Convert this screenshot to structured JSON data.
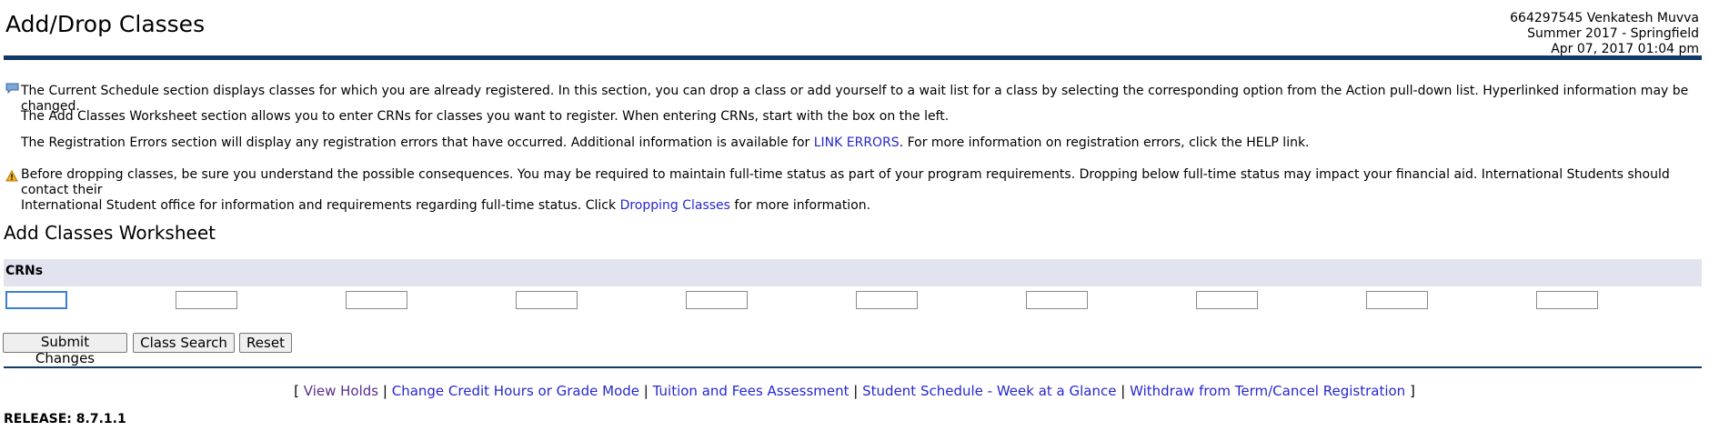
{
  "header": {
    "title": "Add/Drop Classes",
    "user_line": "664297545 Venkatesh Muvva",
    "term_line": "Summer 2017 - Springfield",
    "date_line": "Apr 07, 2017 01:04 pm"
  },
  "info": {
    "line1": "The Current Schedule section displays classes for which you are already registered. In this section, you can drop a class or add yourself to a wait list for a class by selecting the corresponding option from the Action pull-down list. Hyperlinked information may be changed.",
    "line2": "The Add Classes Worksheet section allows you to enter CRNs for classes you want to register. When entering CRNs, start with the box on the left.",
    "line3_before": "The Registration Errors section will display any registration errors that have occurred. Additional information is available for ",
    "line3_link": "LINK ERRORS",
    "line3_after": ". For more information on registration errors, click the HELP link."
  },
  "warning": {
    "line1": "Before dropping classes, be sure you understand the possible consequences. You may be required to maintain full-time status as part of your program requirements. Dropping below full-time status may impact your financial aid. International Students should contact their",
    "line2_before": "International Student office for information and requirements regarding full-time status. Click ",
    "line2_link": "Dropping Classes",
    "line2_after": " for more information."
  },
  "worksheet": {
    "title": "Add Classes Worksheet",
    "crn_label": "CRNs",
    "crn_values": [
      "",
      "",
      "",
      "",
      "",
      "",
      "",
      "",
      "",
      ""
    ]
  },
  "buttons": {
    "submit": "Submit Changes",
    "class_search": "Class Search",
    "reset": "Reset"
  },
  "footer": {
    "open_bracket": "[",
    "close_bracket": "]",
    "separator": "|",
    "links": [
      "View Holds",
      "Change Credit Hours or Grade Mode",
      "Tuition and Fees Assessment",
      "Student Schedule - Week at a Glance",
      "Withdraw from Term/Cancel Registration"
    ]
  },
  "release": "RELEASE: 8.7.1.1",
  "colors": {
    "header_rule": "#0e3968",
    "crn_band": "#e1e4ee",
    "link": "#2727d0",
    "visited_link": "#5a2d8c"
  }
}
